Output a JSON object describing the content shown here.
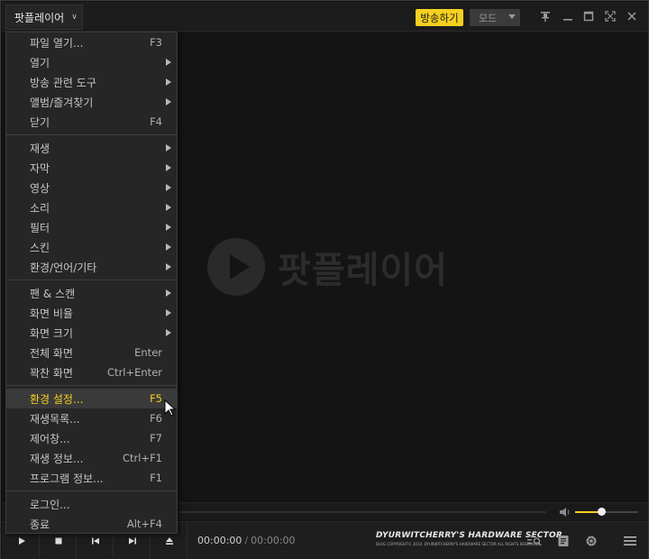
{
  "titlebar": {
    "app_menu_label": "팟플레이어",
    "broadcast_label": "방송하기",
    "mode_label": "모드"
  },
  "video": {
    "logo_text": "팟플레이어"
  },
  "menu": {
    "items": [
      {
        "label": "파일 열기...",
        "shortcut": "F3"
      },
      {
        "label": "열기",
        "shortcut": ""
      },
      {
        "label": "방송 관련 도구",
        "shortcut": ""
      },
      {
        "label": "앨범/즐겨찾기",
        "shortcut": ""
      },
      {
        "label": "닫기",
        "shortcut": "F4"
      },
      {
        "label": "재생",
        "shortcut": ""
      },
      {
        "label": "자막",
        "shortcut": ""
      },
      {
        "label": "영상",
        "shortcut": ""
      },
      {
        "label": "소리",
        "shortcut": ""
      },
      {
        "label": "필터",
        "shortcut": ""
      },
      {
        "label": "스킨",
        "shortcut": ""
      },
      {
        "label": "환경/언어/기타",
        "shortcut": ""
      },
      {
        "label": "팬 & 스캔",
        "shortcut": ""
      },
      {
        "label": "화면 비율",
        "shortcut": ""
      },
      {
        "label": "화면 크기",
        "shortcut": ""
      },
      {
        "label": "전체 화면",
        "shortcut": "Enter"
      },
      {
        "label": "꽉찬 화면",
        "shortcut": "Ctrl+Enter"
      },
      {
        "label": "환경 설정...",
        "shortcut": "F5"
      },
      {
        "label": "재생목록...",
        "shortcut": "F6"
      },
      {
        "label": "제어창...",
        "shortcut": "F7"
      },
      {
        "label": "재생 정보...",
        "shortcut": "Ctrl+F1"
      },
      {
        "label": "프로그램 정보...",
        "shortcut": "F1"
      },
      {
        "label": "로그인...",
        "shortcut": ""
      },
      {
        "label": "종료",
        "shortcut": "Alt+F4"
      }
    ]
  },
  "controls": {
    "time_current": "00:00:00",
    "time_separator": "/",
    "time_total": "00:00:00",
    "brand_title": "DYURWITCHERRY'S HARDWARE SECTOR",
    "brand_copyright": "BLOG COPYRIGHT© 2010. DYURWITCHERRY'S HARDWARE SECTOR ALL RIGHTS RESERVED."
  },
  "volume": {
    "level": 0.42
  },
  "colors": {
    "accent": "#f5d020",
    "background": "#141414",
    "menu_bg": "#262626"
  }
}
